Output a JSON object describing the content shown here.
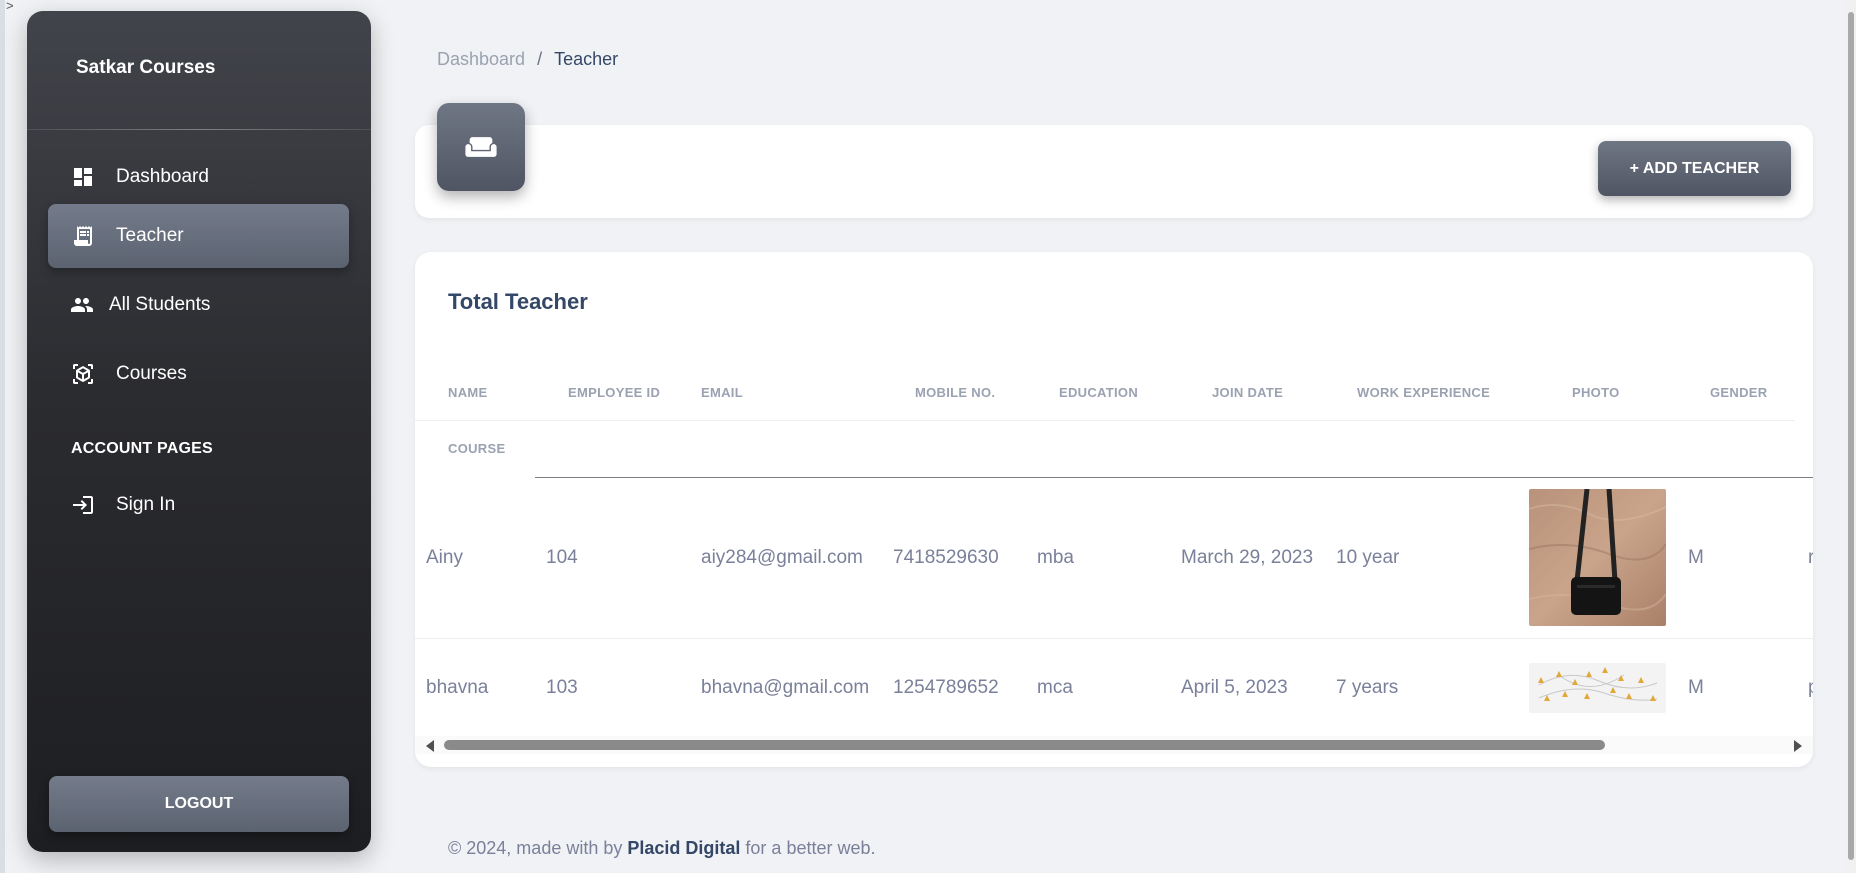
{
  "sidebar": {
    "brand": "Satkar Courses",
    "items": [
      {
        "label": "Dashboard",
        "icon": "dashboard-icon"
      },
      {
        "label": "Teacher",
        "icon": "receipt-icon",
        "active": true
      },
      {
        "label": "All Students",
        "icon": "people-icon"
      },
      {
        "label": "Courses",
        "icon": "view-in-ar-icon"
      }
    ],
    "account_section": "ACCOUNT PAGES",
    "account_items": [
      {
        "label": "Sign In",
        "icon": "login-icon"
      }
    ],
    "logout_label": "LOGOUT"
  },
  "breadcrumb": {
    "parent": "Dashboard",
    "separator": "/",
    "current": "Teacher"
  },
  "header": {
    "icon": "weekend-icon",
    "add_button": "+ ADD TEACHER"
  },
  "table": {
    "title": "Total Teacher",
    "columns": [
      "NAME",
      "EMPLOYEE ID",
      "EMAIL",
      "MOBILE NO.",
      "EDUCATION",
      "JOIN DATE",
      "WORK EXPERIENCE",
      "PHOTO",
      "GENDER",
      "COURSE"
    ],
    "rows": [
      {
        "name": "Ainy",
        "employee_id": "104",
        "email": "aiy284@gmail.com",
        "mobile": "7418529630",
        "education": "mba",
        "join_date": "March 29, 2023",
        "experience": "10 year",
        "photo": "bag-on-fur-photo",
        "gender": "M",
        "course": "r"
      },
      {
        "name": "bhavna",
        "employee_id": "103",
        "email": "bhavna@gmail.com",
        "mobile": "1254789652",
        "education": "mca",
        "join_date": "April 5, 2023",
        "experience": "7 years",
        "photo": "network-diagram-photo",
        "gender": "M",
        "course": "p"
      }
    ]
  },
  "footer": {
    "prefix": "© 2024, made with by",
    "brand": "Placid Digital",
    "suffix": "for a better web."
  },
  "colors": {
    "sidebar_top": "#42444b",
    "sidebar_bottom": "#1d1e21",
    "accent": "#5b6270",
    "page_bg": "#f0f2f5",
    "heading": "#344767",
    "muted": "#7b809a"
  }
}
